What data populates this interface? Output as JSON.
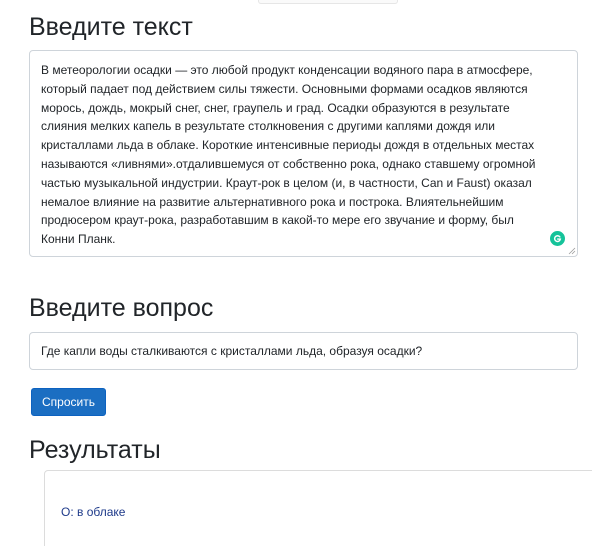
{
  "text_section": {
    "title": "Введите текст",
    "text_value": "В метеорологии осадки — это любой продукт конденсации водяного пара в атмосфере,\nкоторый падает под действием силы тяжести. Основными формами осадков являются\nморось, дождь, мокрый снег, снег, граупель и град. Осадки образуются в результате\nслияния мелких капель в результате столкновения с другими каплями дождя или\nкристаллами льда в облаке. Короткие интенсивные периоды дождя в отдельных местах\nназываются «ливнями».отдалившемуся от собственно рока, однако ставшему огромной\nчастью музыкальной индустрии. Краут-рок в целом (и, в частности, Can и Faust) оказал\nнемалое влияние на развитие альтернативного рока и построка. Влиятельнейшим\nпродюсером краут-рока, разработавшим в какой-то мере его звучание и форму, был\nКонни Планк."
  },
  "question_section": {
    "title": "Введите вопрос",
    "question_value": "Где капли воды сталкиваются с кристаллами льда, образуя осадки?"
  },
  "ask_button": {
    "label": "Спросить"
  },
  "results_section": {
    "title": "Результаты",
    "answer": "О: в облаке"
  },
  "colors": {
    "button_bg": "#1b6ec2",
    "answer_text": "#1e3a8a",
    "grammarly": "#15c39a"
  },
  "icons": {
    "grammarly": "grammarly-icon",
    "resize": "resize-handle-icon"
  }
}
